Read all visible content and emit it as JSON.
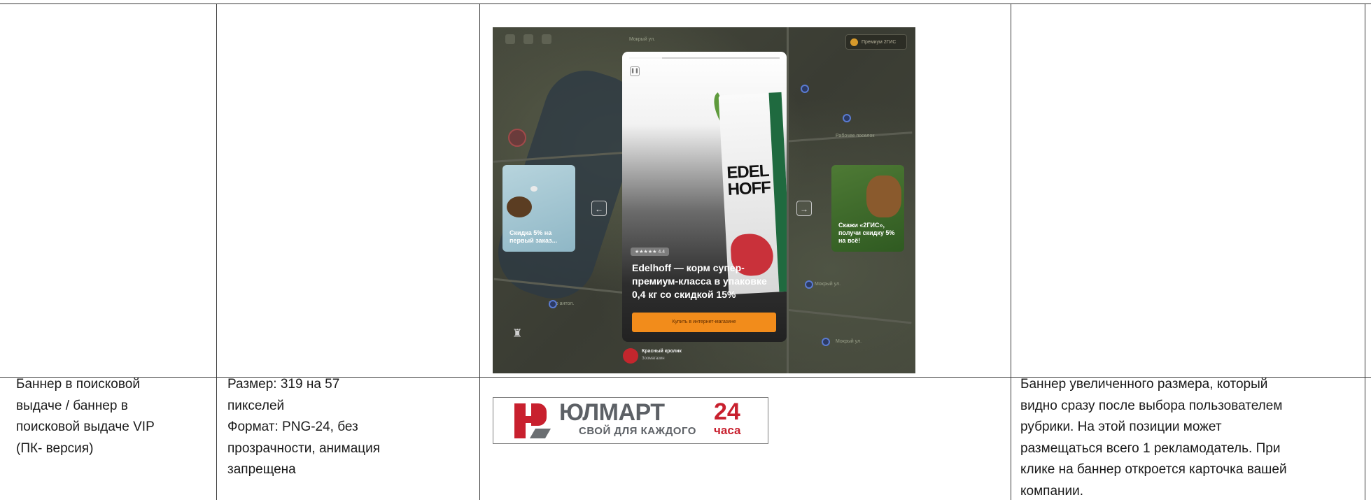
{
  "table": {
    "row2": {
      "placement": "Баннер в поисковой\nвыдаче / баннер в\nпоисковой выдаче VIP\n(ПК- версия)",
      "specs": "Размер: 319 на 57\nпикселей\nФормат: PNG-24, без\nпрозрачности, анимация\nзапрещена",
      "description": "Баннер увеличенного размера, который\nвидно сразу после выбора пользователем\nрубрики. На этой позиции может\nразмещаться всего 1 рекламодатель. При\nклике на баннер откроется карточка вашей\nкомпании."
    }
  },
  "screenshot": {
    "premium_label": "Премиум 2ГИС",
    "story": {
      "rating": "★★★★★ 4.4",
      "title": "Edelhoff — корм супер-премиум-класса в упаковке 0,4 кг со скидкой 15%",
      "button": "Купить в интернет-магазине",
      "brand_on_pack": "EDEL\nHOFF"
    },
    "left_card_text": "Скидка 5% на первый заказ...",
    "right_card_text": "Скажи «2ГИС», получи скидку 5% на всё!",
    "shop_name": "Красный кролик",
    "shop_type": "Зоомагазин",
    "map_labels": [
      "Мокрый ул.",
      "Мир антол.",
      "Мокрый ул.",
      "Мокрый ул.",
      "Рабочее поселок"
    ]
  },
  "banner": {
    "title": "ЮЛМАРТ",
    "tagline": "СВОЙ ДЛЯ КАЖДОГО",
    "number": "24",
    "hours": "часа"
  },
  "icons": [
    "pause-icon",
    "arrow-left-icon",
    "arrow-right-icon",
    "crown-icon",
    "heart-icon",
    "yulmart-logo-icon",
    "shop-logo-icon"
  ]
}
